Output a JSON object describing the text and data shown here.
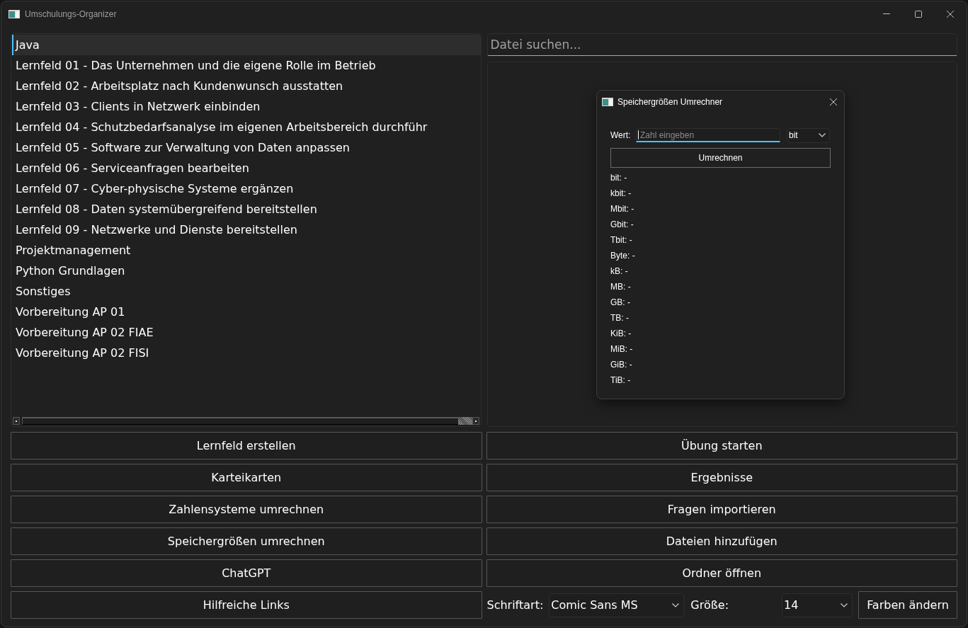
{
  "window": {
    "title": "Umschulungs-Organizer"
  },
  "folder_list": {
    "items": [
      {
        "label": "Java",
        "selected": true
      },
      {
        "label": "Lernfeld 01 - Das Unternehmen und die eigene Rolle im Betrieb",
        "selected": false
      },
      {
        "label": "Lernfeld 02 - Arbeitsplatz nach Kundenwunsch ausstatten",
        "selected": false
      },
      {
        "label": "Lernfeld 03 - Clients in Netzwerk einbinden",
        "selected": false
      },
      {
        "label": "Lernfeld 04 - Schutzbedarfsanalyse im eigenen Arbeitsbereich durchführ",
        "selected": false
      },
      {
        "label": "Lernfeld 05 - Software zur Verwaltung von Daten anpassen",
        "selected": false
      },
      {
        "label": "Lernfeld 06 - Serviceanfragen bearbeiten",
        "selected": false
      },
      {
        "label": "Lernfeld 07 - Cyber-physische Systeme ergänzen",
        "selected": false
      },
      {
        "label": "Lernfeld 08 - Daten systemübergreifend bereitstellen",
        "selected": false
      },
      {
        "label": "Lernfeld 09 - Netzwerke und Dienste bereitstellen",
        "selected": false
      },
      {
        "label": "Projektmanagement",
        "selected": false
      },
      {
        "label": "Python Grundlagen",
        "selected": false
      },
      {
        "label": "Sonstiges",
        "selected": false
      },
      {
        "label": "Vorbereitung AP 01",
        "selected": false
      },
      {
        "label": "Vorbereitung AP 02 FIAE",
        "selected": false
      },
      {
        "label": "Vorbereitung AP 02 FISI",
        "selected": false
      }
    ]
  },
  "search": {
    "placeholder": "Datei suchen..."
  },
  "dialog": {
    "title": "Speichergrößen Umrechner",
    "value_label": "Wert:",
    "value_field": {
      "placeholder": "Zahl eingeben",
      "focused": true
    },
    "unit_select": {
      "value": "bit"
    },
    "convert_button": "Umrechnen",
    "results": [
      "bit: -",
      "kbit: -",
      "Mbit: -",
      "Gbit: -",
      "Tbit: -",
      "Byte: -",
      "kB: -",
      "MB: -",
      "GB: -",
      "TB: -",
      "KiB: -",
      "MiB: -",
      "GiB: -",
      "TiB: -"
    ]
  },
  "buttons": [
    "Lernfeld erstellen",
    "Übung starten",
    "Karteikarten",
    "Ergebnisse",
    "Zahlensysteme umrechnen",
    "Fragen importieren",
    "Speichergrößen umrechnen",
    "Dateien hinzufügen",
    "ChatGPT",
    "Ordner öffnen",
    "Hilfreiche Links"
  ],
  "font_bar": {
    "font_label": "Schriftart:",
    "font_value": "Comic Sans MS",
    "size_label": "Größe:",
    "size_value": "14",
    "colors_button": "Farben ändern"
  }
}
